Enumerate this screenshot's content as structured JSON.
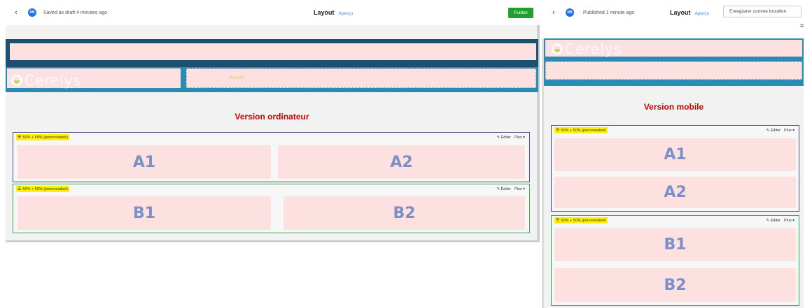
{
  "desktop": {
    "topbar": {
      "status": "Saved as draft 4 minutes ago",
      "avatar": "RB",
      "title": "Layout",
      "preview": "Aperçu",
      "publish": "Publier"
    },
    "header": {
      "logo": "Cerelys",
      "nav_item": "Accueil"
    },
    "version_title": "Version ordinateur",
    "blocks": [
      {
        "tag": "50% + 50% (personnalisé)",
        "edit": "Éditer",
        "more": "Plus",
        "border": "#4a4a7a",
        "cells": [
          "A1",
          "A2"
        ]
      },
      {
        "tag": "50% + 50% (personnalisé)",
        "edit": "Éditer",
        "more": "Plus",
        "border": "#3aa84a",
        "cells": [
          "B1",
          "B2"
        ]
      }
    ]
  },
  "mobile": {
    "topbar": {
      "status": "Published 1 minute ago",
      "avatar": "RB",
      "title": "Layout",
      "preview": "Aperçu",
      "save_draft": "Enregistrer comme brouillon"
    },
    "header": {
      "logo": "Cerelys"
    },
    "version_title": "Version mobile",
    "blocks": [
      {
        "tag": "50% + 50% (personnalisé)",
        "edit": "Éditer",
        "more": "Plus",
        "border": "#4a4a7a",
        "cells": [
          "A1",
          "A2"
        ]
      },
      {
        "tag": "50% + 50% (personnalisé)",
        "edit": "Éditer",
        "more": "Plus",
        "border": "#3aa84a",
        "cells": [
          "B1",
          "B2"
        ]
      }
    ]
  },
  "icons": {
    "back": "chevron-left-icon",
    "menu": "hamburger-icon",
    "edit": "pencil-icon",
    "more": "caret-down-icon"
  },
  "colors": {
    "publish_green": "#1fa02e",
    "accent_blue": "#1e6fe0",
    "header_teal": "#2a8bb5",
    "header_dark": "#1f4f6e",
    "cell_pink": "#fde1e1",
    "version_red": "#cc0000",
    "tag_yellow": "#fff200"
  }
}
